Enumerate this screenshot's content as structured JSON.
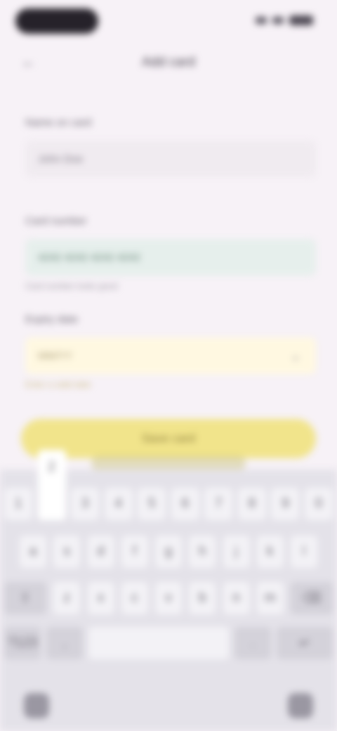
{
  "app_bar": {
    "title": "Add card",
    "back_icon": "arrow-back-icon"
  },
  "fields": [
    {
      "label": "Name on card",
      "value": "John Doe",
      "helper": "",
      "state": "plain"
    },
    {
      "label": "Card number",
      "value": "4242 4242 4242 4242",
      "helper": "Card number looks good",
      "state": "ok"
    },
    {
      "label": "Expiry date",
      "value": "MM/YY",
      "helper": "Enter a valid date",
      "state": "warn",
      "trailing_icon": "chevron-down-icon"
    }
  ],
  "cta": {
    "label": "Save card"
  },
  "keyboard": {
    "row1": [
      "1",
      "2",
      "3",
      "4",
      "5",
      "6",
      "7",
      "8",
      "9",
      "0"
    ],
    "row2": [
      "a",
      "s",
      "d",
      "f",
      "g",
      "h",
      "j",
      "k",
      "l"
    ],
    "row3": [
      "⇧",
      "z",
      "x",
      "c",
      "v",
      "b",
      "n",
      "m",
      "⌫"
    ],
    "row4": [
      "?123",
      ",",
      "",
      "",
      ".",
      "↵"
    ]
  },
  "colors": {
    "background": "#f7f2f7",
    "cta": "#f1e48b",
    "valid_field": "#e6efec",
    "keyboard": "#e4e2e9"
  }
}
